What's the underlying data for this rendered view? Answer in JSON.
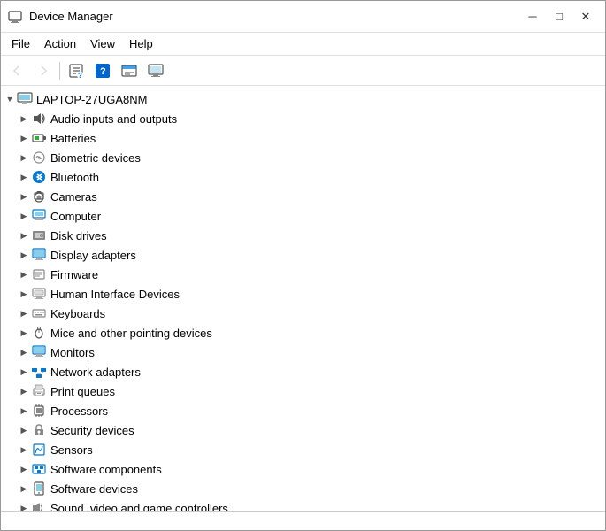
{
  "window": {
    "title": "Device Manager",
    "min_btn": "─",
    "max_btn": "□",
    "close_btn": "✕"
  },
  "menubar": {
    "items": [
      {
        "id": "file",
        "label": "File"
      },
      {
        "id": "action",
        "label": "Action"
      },
      {
        "id": "view",
        "label": "View"
      },
      {
        "id": "help",
        "label": "Help"
      }
    ]
  },
  "toolbar": {
    "buttons": [
      {
        "id": "back",
        "icon": "◀",
        "disabled": true
      },
      {
        "id": "forward",
        "icon": "▶",
        "disabled": true
      },
      {
        "id": "properties",
        "icon": "🗒",
        "disabled": false
      },
      {
        "id": "help",
        "icon": "?",
        "disabled": false
      },
      {
        "id": "update",
        "icon": "⊞",
        "disabled": false
      },
      {
        "id": "monitor",
        "icon": "🖥",
        "disabled": false
      }
    ]
  },
  "tree": {
    "root": {
      "label": "LAPTOP-27UGA8NM",
      "expanded": true,
      "children": [
        {
          "id": "audio",
          "label": "Audio inputs and outputs",
          "icon": "🔊",
          "color": "#666"
        },
        {
          "id": "batteries",
          "label": "Batteries",
          "icon": "🔋",
          "color": "#666"
        },
        {
          "id": "biometric",
          "label": "Biometric devices",
          "icon": "⚙",
          "color": "#888"
        },
        {
          "id": "bluetooth",
          "label": "Bluetooth",
          "icon": "⬤",
          "color": "#0078d4"
        },
        {
          "id": "cameras",
          "label": "Cameras",
          "icon": "📷",
          "color": "#666"
        },
        {
          "id": "computer",
          "label": "Computer",
          "icon": "🖥",
          "color": "#0078d4"
        },
        {
          "id": "disk",
          "label": "Disk drives",
          "icon": "💾",
          "color": "#666"
        },
        {
          "id": "display",
          "label": "Display adapters",
          "icon": "🖥",
          "color": "#0078d4"
        },
        {
          "id": "firmware",
          "label": "Firmware",
          "icon": "⌨",
          "color": "#888"
        },
        {
          "id": "hid",
          "label": "Human Interface Devices",
          "icon": "🕹",
          "color": "#888"
        },
        {
          "id": "keyboards",
          "label": "Keyboards",
          "icon": "⌨",
          "color": "#888"
        },
        {
          "id": "mice",
          "label": "Mice and other pointing devices",
          "icon": "🖱",
          "color": "#888"
        },
        {
          "id": "monitors",
          "label": "Monitors",
          "icon": "🖥",
          "color": "#0078d4"
        },
        {
          "id": "network",
          "label": "Network adapters",
          "icon": "🌐",
          "color": "#0078d4"
        },
        {
          "id": "print",
          "label": "Print queues",
          "icon": "🖨",
          "color": "#888"
        },
        {
          "id": "processors",
          "label": "Processors",
          "icon": "⬛",
          "color": "#888"
        },
        {
          "id": "security",
          "label": "Security devices",
          "icon": "🔒",
          "color": "#888"
        },
        {
          "id": "sensors",
          "label": "Sensors",
          "icon": "📡",
          "color": "#0078d4"
        },
        {
          "id": "sw_components",
          "label": "Software components",
          "icon": "📦",
          "color": "#0078d4"
        },
        {
          "id": "sw_devices",
          "label": "Software devices",
          "icon": "📱",
          "color": "#888"
        },
        {
          "id": "sound",
          "label": "Sound, video and game controllers",
          "icon": "🎵",
          "color": "#888"
        }
      ]
    }
  },
  "statusbar": {
    "text": ""
  }
}
